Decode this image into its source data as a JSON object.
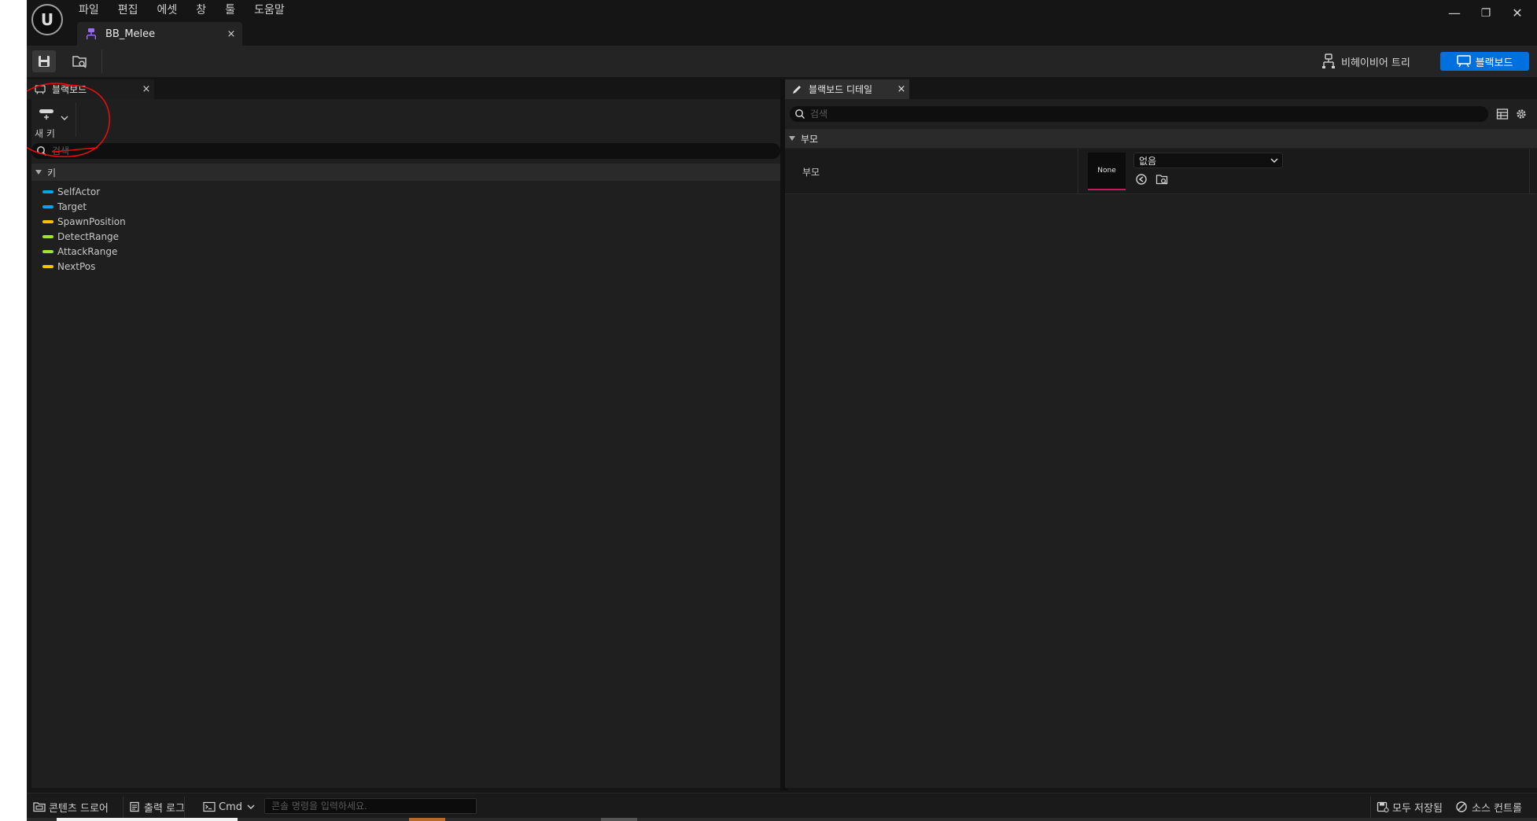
{
  "menu": {
    "items": [
      "파일",
      "편집",
      "에셋",
      "창",
      "툴",
      "도움말"
    ]
  },
  "logo": {
    "glyph": "U"
  },
  "tab": {
    "title": "BB_Melee",
    "close": "×"
  },
  "window_controls": {
    "minimize": "—",
    "restore": "❐",
    "close": "✕"
  },
  "toolbar": {
    "behavior_tree_label": "비헤이비어 트리",
    "blackboard_label": "블랙보드",
    "accent_color": "#0070e0"
  },
  "left_panel": {
    "tab_label": "블랙보드",
    "tab_close": "×",
    "new_key_label": "새 키",
    "search_placeholder": "검색",
    "keys_header": "키",
    "keys": [
      {
        "name": "SelfActor",
        "color": "#00a8e8"
      },
      {
        "name": "Target",
        "color": "#00a8e8"
      },
      {
        "name": "SpawnPosition",
        "color": "#f5c400"
      },
      {
        "name": "DetectRange",
        "color": "#9ee335"
      },
      {
        "name": "AttackRange",
        "color": "#9ee335"
      },
      {
        "name": "NextPos",
        "color": "#f5c400"
      }
    ]
  },
  "right_panel": {
    "tab_label": "블랙보드 디테일",
    "tab_close": "×",
    "search_placeholder": "검색",
    "category": "부모",
    "property": {
      "name": "부모",
      "thumbnail_text": "None",
      "combo_value": "없음"
    }
  },
  "status_bar": {
    "content_drawer": "콘텐츠 드로어",
    "output_log": "출력 로그",
    "cmd": "Cmd",
    "console_placeholder": "콘솔 명령을 입력하세요.",
    "save_all": "모두 저장됨",
    "source_control": "소스 컨트롤"
  },
  "annotation": {
    "color": "#e01010"
  }
}
